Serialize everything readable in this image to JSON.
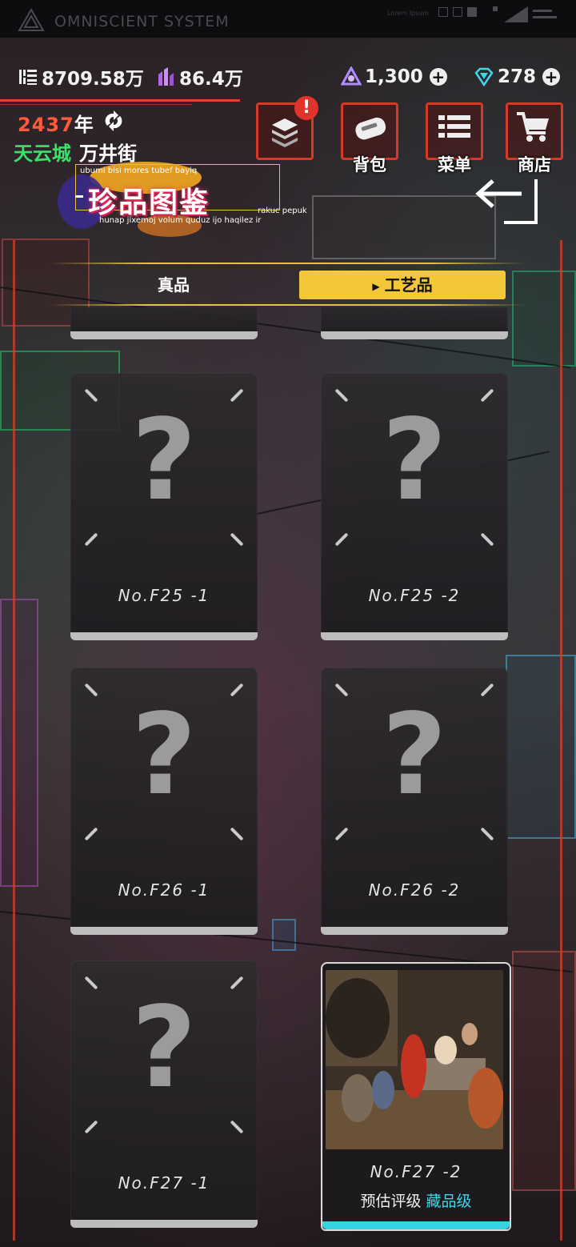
{
  "system_bar": {
    "title": "OMNISCIENT SYSTEM",
    "lorem": "Lorem Ipsum"
  },
  "stats": {
    "chips": "8709.58万",
    "crystals": "86.4万",
    "orbs": "1,300",
    "gems": "278"
  },
  "header": {
    "year_num": "2437",
    "year_char": "年",
    "city": "天云城",
    "street": "万井街"
  },
  "nav": [
    {
      "label": "",
      "icon": "collection-stack-icon",
      "badge": "!"
    },
    {
      "label": "背包",
      "icon": "backpack-icon"
    },
    {
      "label": "菜单",
      "icon": "menu-list-icon"
    },
    {
      "label": "商店",
      "icon": "shop-cart-icon"
    }
  ],
  "title": {
    "small": "ubumi bisi mores tubef bayiq",
    "main": "珍品图鉴",
    "side": "rakuc pepuk",
    "sub": "hunap jixemoj volum quduz ijo haqilez ir"
  },
  "tabs": {
    "real": "真品",
    "craft": "工艺品",
    "active": "craft"
  },
  "cards": [
    {
      "id": "No.F25 -1",
      "status": "locked"
    },
    {
      "id": "No.F25 -2",
      "status": "locked"
    },
    {
      "id": "No.F26 -1",
      "status": "locked"
    },
    {
      "id": "No.F26 -2",
      "status": "locked"
    },
    {
      "id": "No.F27 -1",
      "status": "locked"
    },
    {
      "id": "No.F27 -2",
      "status": "discovered",
      "grade_label": "预估评级",
      "grade_value": "藏品级"
    }
  ],
  "colors": {
    "accent_yellow": "#f2c83a",
    "frame_red": "#e0442c",
    "grade_cyan": "#3fd6e6",
    "location_green": "#3fe06a"
  }
}
